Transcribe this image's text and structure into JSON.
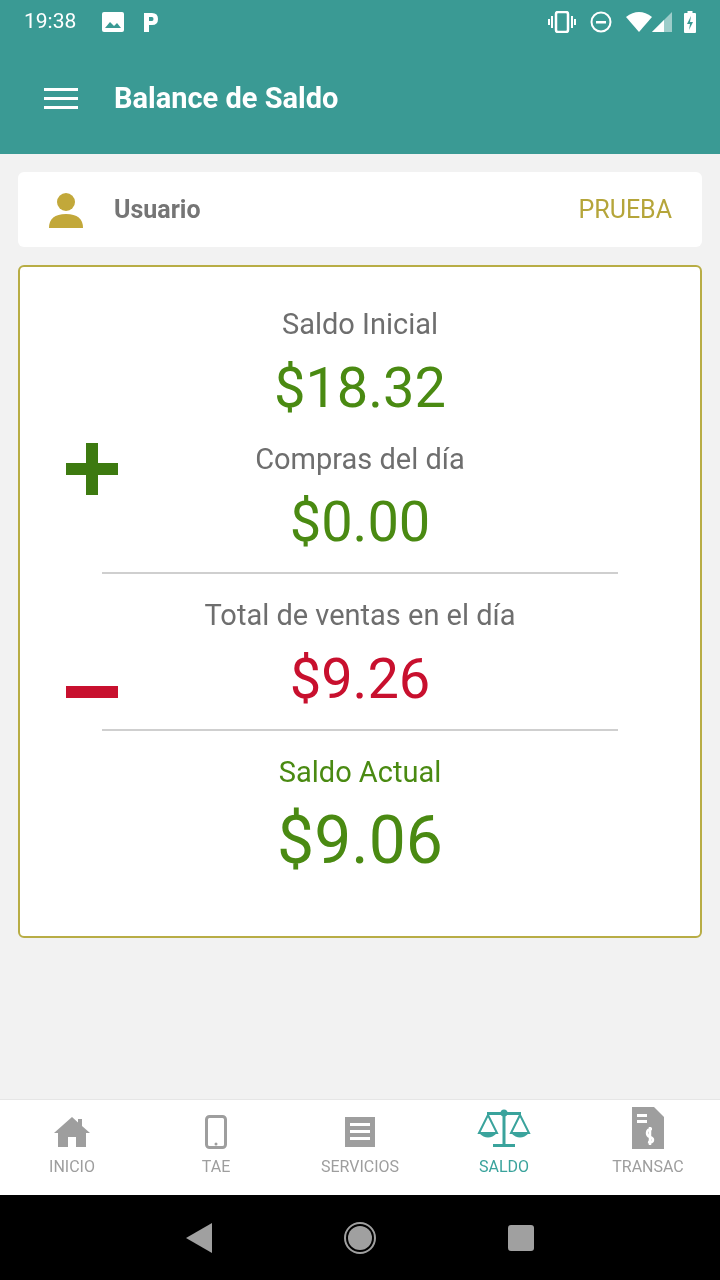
{
  "status_bar": {
    "time": "19:38"
  },
  "app_bar": {
    "title": "Balance de Saldo"
  },
  "user": {
    "label": "Usuario",
    "value": "PRUEBA"
  },
  "balance": [
    {
      "kind": "base",
      "label": "Saldo Inicial",
      "amount": "$18.32"
    },
    {
      "kind": "income",
      "label": "Compras del día",
      "amount": "$0.00"
    },
    {
      "kind": "expense",
      "label": "Total de ventas en el día",
      "amount": "$9.26"
    },
    {
      "kind": "result",
      "label": "Saldo Actual",
      "amount": "$9.06"
    }
  ],
  "bottom_nav": [
    {
      "kind": "home",
      "label": "INICIO",
      "selected": false
    },
    {
      "kind": "phone",
      "label": "TAE",
      "selected": false
    },
    {
      "kind": "receipt",
      "label": "SERVICIOS",
      "selected": false
    },
    {
      "kind": "scale",
      "label": "SALDO",
      "selected": true
    },
    {
      "kind": "invoice",
      "label": "TRANSAC",
      "selected": false
    }
  ]
}
